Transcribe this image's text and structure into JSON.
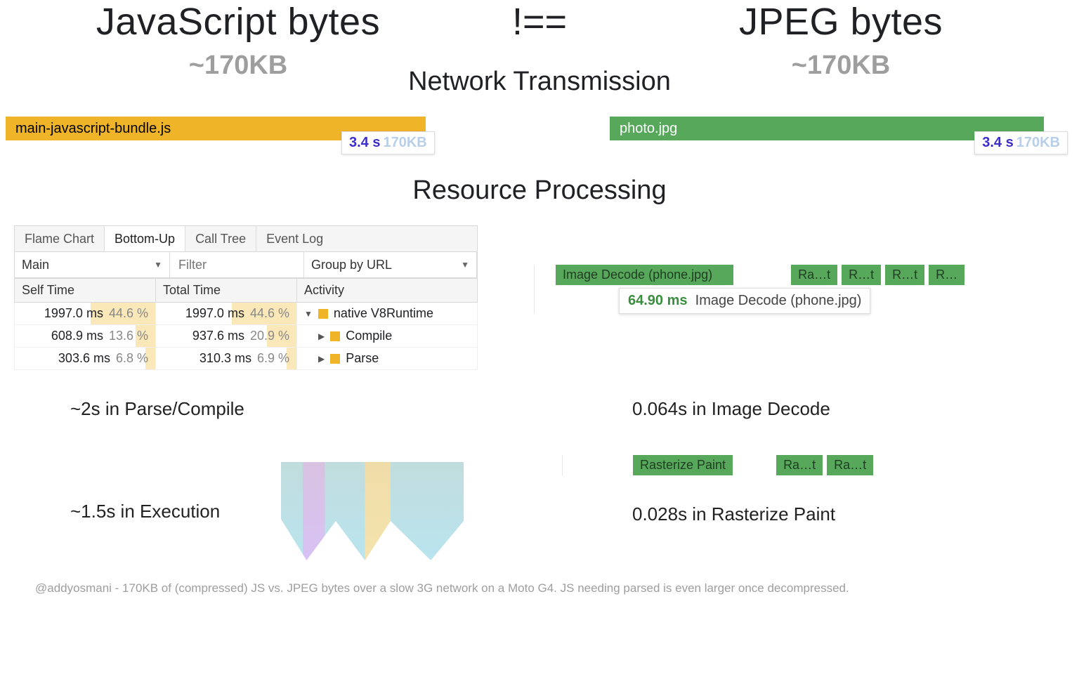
{
  "header": {
    "left_title": "JavaScript bytes",
    "right_title": "JPEG bytes",
    "operator": "!==",
    "left_size": "~170KB",
    "right_size": "~170KB"
  },
  "sections": {
    "network": "Network Transmission",
    "processing": "Resource Processing"
  },
  "bars": {
    "js": {
      "label": "main-javascript-bundle.js",
      "time": "3.4 s",
      "size": "170KB"
    },
    "jpg": {
      "label": "photo.jpg",
      "time": "3.4 s",
      "size": "170KB"
    }
  },
  "profiler": {
    "tabs": [
      "Flame Chart",
      "Bottom-Up",
      "Call Tree",
      "Event Log"
    ],
    "active_tab": "Bottom-Up",
    "thread": "Main",
    "filter_placeholder": "Filter",
    "group_by": "Group by URL",
    "columns": [
      "Self Time",
      "Total Time",
      "Activity"
    ],
    "rows": [
      {
        "self": "1997.0 ms",
        "self_pct": "44.6 %",
        "self_w": 46,
        "total": "1997.0 ms",
        "total_pct": "44.6 %",
        "total_w": 46,
        "activity": "native V8Runtime",
        "icon": "▼"
      },
      {
        "self": "608.9 ms",
        "self_pct": "13.6 %",
        "self_w": 14,
        "total": "937.6 ms",
        "total_pct": "20.9 %",
        "total_w": 21,
        "activity": "Compile",
        "icon": "▶",
        "indent": true
      },
      {
        "self": "303.6 ms",
        "self_pct": "6.8 %",
        "self_w": 7,
        "total": "310.3 ms",
        "total_pct": "6.9 %",
        "total_w": 7,
        "activity": "Parse",
        "icon": "▶",
        "indent": true
      }
    ]
  },
  "decode": {
    "main": "Image Decode (phone.jpg)",
    "extras": [
      "Ra…t",
      "R…t",
      "R…t",
      "R…"
    ],
    "tooltip_time": "64.90 ms",
    "tooltip_label": "Image Decode (phone.jpg)"
  },
  "captions": {
    "parse_compile": "~2s in Parse/Compile",
    "execution": "~1.5s in Execution",
    "image_decode": "0.064s in Image Decode",
    "raster": "0.028s in Rasterize Paint"
  },
  "raster": {
    "segs": [
      "Rasterize Paint",
      "Ra…t",
      "Ra…t"
    ]
  },
  "credit": "@addyosmani - 170KB of (compressed) JS vs. JPEG bytes over a slow 3G network on a Moto G4. JS needing parsed is even larger once decompressed."
}
